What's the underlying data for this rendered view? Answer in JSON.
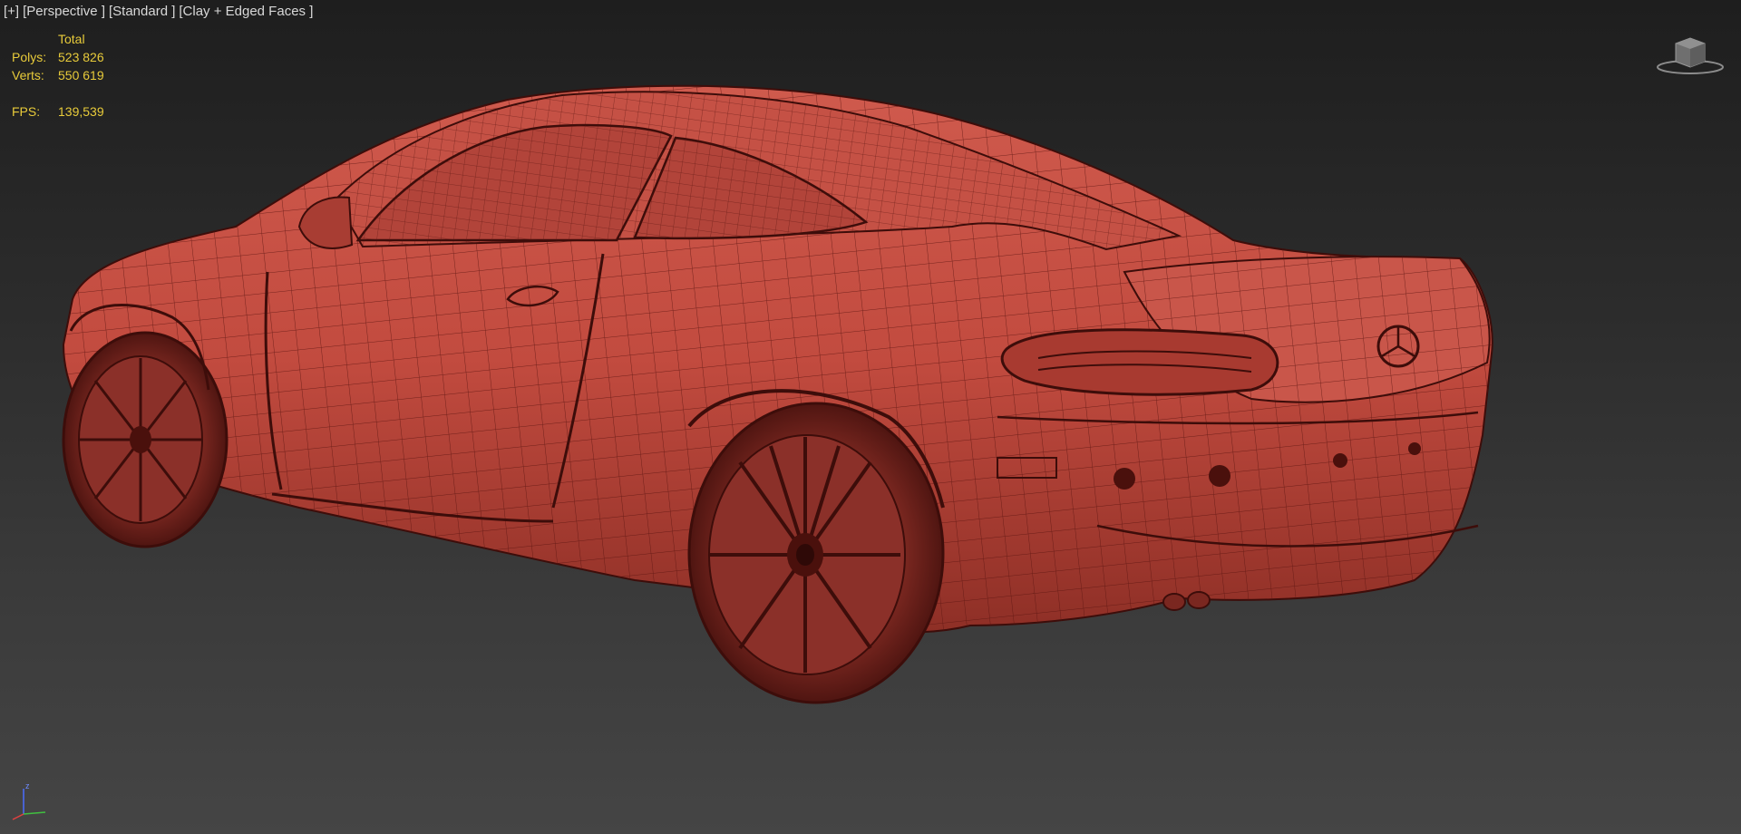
{
  "viewport": {
    "labels": [
      "[+]",
      "[Perspective ]",
      "[Standard ]",
      "[Clay + Edged Faces ]"
    ]
  },
  "stats": {
    "header": "Total",
    "polys_label": "Polys:",
    "polys_value": "523 826",
    "verts_label": "Verts:",
    "verts_value": "550 619",
    "fps_label": "FPS:",
    "fps_value": "139,539"
  },
  "gizmo": {
    "axis_z": "z"
  },
  "colors": {
    "stats_text": "#e8cb3a",
    "label_text": "#d8d8d8",
    "clay": "#c24b3f",
    "wire": "#5a1410"
  },
  "icons": {
    "viewcube": "viewcube-icon",
    "axis": "axis-tripod-icon"
  }
}
